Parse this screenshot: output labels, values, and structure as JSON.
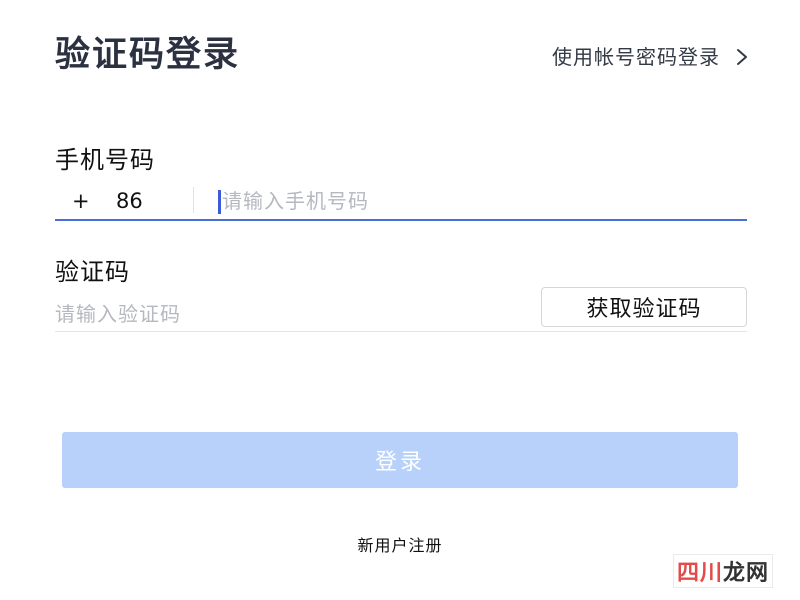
{
  "header": {
    "title": "验证码登录",
    "switch_label": "使用帐号密码登录",
    "switch_icon": "chevron-right-icon"
  },
  "phone": {
    "label": "手机号码",
    "country_plus": "+",
    "country_code": "86",
    "placeholder": "请输入手机号码",
    "value": ""
  },
  "code": {
    "label": "验证码",
    "placeholder": "请输入验证码",
    "value": "",
    "get_code_label": "获取验证码"
  },
  "login": {
    "label": "登录"
  },
  "register": {
    "label": "新用户注册"
  },
  "watermark": {
    "part1": "四川",
    "part2": "龙网"
  },
  "colors": {
    "title": "#2b3140",
    "focus_line": "#4a6fd4",
    "caret": "#3b5bd9",
    "login_disabled_bg": "#b7d1fa",
    "placeholder": "#b5b8bf"
  }
}
